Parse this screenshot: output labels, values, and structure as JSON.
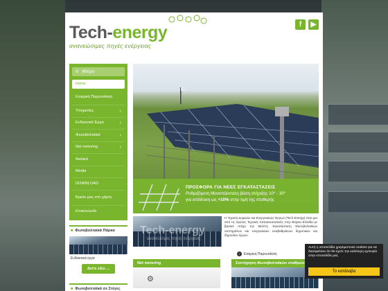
{
  "header": {
    "logo_main": "Tech-",
    "logo_accent": "energy",
    "tagline": "ανανεώσιμες πηγές ενέργειας",
    "social": [
      {
        "name": "facebook-icon",
        "glyph": "f"
      },
      {
        "name": "youtube-icon",
        "glyph": "▶"
      }
    ]
  },
  "sidebar": {
    "filter_label": "Φίλτρο",
    "items": [
      {
        "label": "Home",
        "submenu": false
      },
      {
        "label": "Εταιρική Παρουσίαση",
        "submenu": false
      },
      {
        "label": "Υπηρεσίες",
        "submenu": true
      },
      {
        "label": "Ενδεικτικά Έργα",
        "submenu": true
      },
      {
        "label": "Φωτοβολταϊκά",
        "submenu": true
      },
      {
        "label": "Net metering",
        "submenu": true
      },
      {
        "label": "Αιολικά",
        "submenu": false
      },
      {
        "label": "Media",
        "submenu": false
      },
      {
        "label": "DOWNLOAD",
        "submenu": false
      },
      {
        "label": "Βρείτε μας στο χάρτη",
        "submenu": false
      },
      {
        "label": "Επικοινωνία",
        "submenu": false
      }
    ],
    "box1": {
      "title": "Φωτοβολταϊκά Πάρκα",
      "caption": "Ενδεικτικά έργα",
      "button": "Δείτε εδώ ..."
    },
    "box2": {
      "title": "Φωτοβολταϊκά σε Στέγες"
    }
  },
  "hero": {
    "banner_title": "ΠΡΟΣΦΟΡΑ ΓΙΑ ΝΕΕΣ ΕΓΚΑΤΑΣΤΑΣΕΙΣ",
    "banner_line1": "Ρυθμιζόμενη Μονοπάσσαλη βάση στήριξης 10° - 30°",
    "banner_line2_a": "για απόδοση ως",
    "banner_line2_b": "+10%",
    "banner_line2_c": "στην τιμή της σταθερής"
  },
  "about": {
    "watermark": "Tech-energy",
    "watermark_sub": "ανανεώσιμες πηγές ενέργειας",
    "text": "Η Τεχνική Δομικών και Ενεργειακών Έργων (Tech Energy) είναι μια από τις πρώτες Τεχνικές Κατασκευαστικές στην Βόρεια Ελλάδα με βασικό στόχο την Μελέτη -Εγκατάσταση Φωτοβολταϊκών συστημάτων και ενεργειακών αναβαθμίσεων δημοτικών και δημοσίων έργων",
    "link": "Εταιρική Παρουσίαση"
  },
  "cards": [
    {
      "title": "Net metering"
    },
    {
      "title": "Συντήρηση Φωτοβολταϊκών σταθμών"
    }
  ],
  "cookie": {
    "text": "Αυτή η ιστοσελίδα χρησιμοποιεί cookies για να διασφαλίσει ότι θα έχετε την καλύτερη εμπειρία στην ιστοσελίδα μας",
    "button": "Το κατάλαβα"
  },
  "colors": {
    "brand_green": "#7ab52e",
    "cookie_button": "#f5c518"
  }
}
